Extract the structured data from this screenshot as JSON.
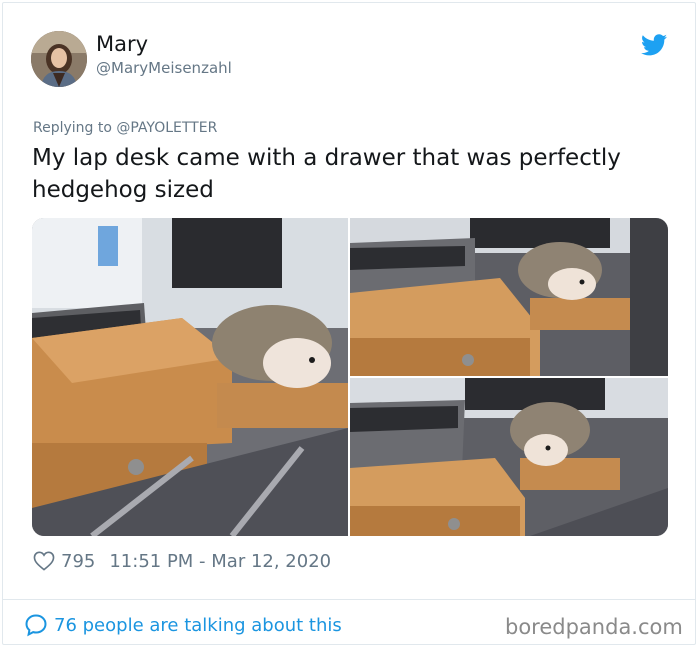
{
  "author": {
    "name": "Mary",
    "handle": "@MaryMeisenzahl"
  },
  "tweet": {
    "replying_to": "Replying to @PAYOLETTER",
    "text": "My lap desk came with a drawer that was perfectly hedgehog sized"
  },
  "footer": {
    "like_count": "795",
    "timestamp": "11:51 PM - Mar 12, 2020",
    "talking": "76 people are talking about this"
  },
  "watermark": "boredpanda.com",
  "icons": {
    "like": "heart-icon",
    "brand": "twitter-bird-icon",
    "conversation": "speech-bubble-icon"
  },
  "colors": {
    "link_blue": "#1b95e0",
    "twitter_blue": "#1da1f2",
    "muted_gray": "#657786"
  }
}
